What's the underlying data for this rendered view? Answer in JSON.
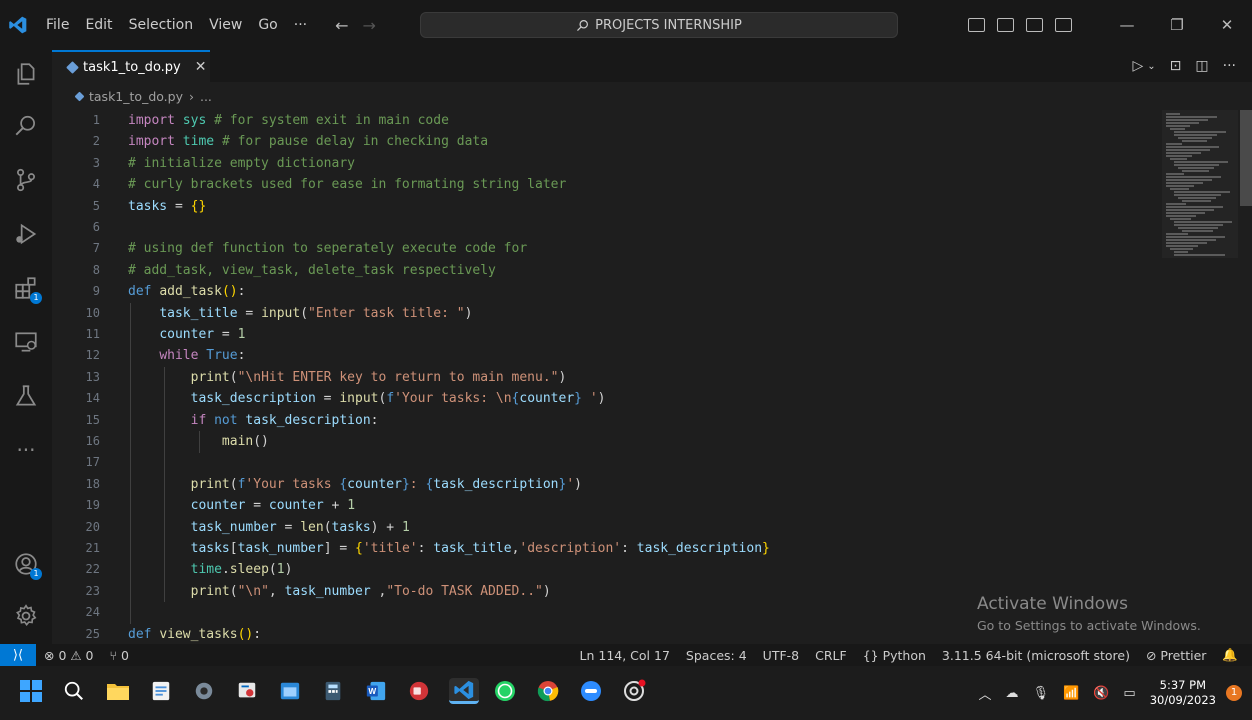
{
  "titlebar": {
    "menu": [
      "File",
      "Edit",
      "Selection",
      "View",
      "Go",
      "···"
    ],
    "search": "PROJECTS INTERNSHIP"
  },
  "tab": {
    "filename": "task1_to_do.py",
    "close": "✕"
  },
  "breadcrumb": {
    "file": "task1_to_do.py",
    "sep": "›",
    "more": "..."
  },
  "editor": {
    "lines": [
      {
        "n": "1",
        "html": "<span class='kw'>import</span> <span class='mod'>sys</span> <span class='cm'># for system exit in main code</span>"
      },
      {
        "n": "2",
        "html": "<span class='kw'>import</span> <span class='mod'>time</span> <span class='cm'># for pause delay in checking data</span>"
      },
      {
        "n": "3",
        "html": "<span class='cm'># initialize empty dictionary</span>"
      },
      {
        "n": "4",
        "html": "<span class='cm'># curly brackets used for ease in formating string later</span>"
      },
      {
        "n": "5",
        "html": "<span class='var'>tasks</span> = <span class='br'>{}</span>"
      },
      {
        "n": "6",
        "html": ""
      },
      {
        "n": "7",
        "html": "<span class='cm'># using def function to seperately execute code for</span>"
      },
      {
        "n": "8",
        "html": "<span class='cm'># add_task, view_task, delete_task respectively</span>"
      },
      {
        "n": "9",
        "html": "<span class='kw2'>def</span> <span class='fn'>add_task</span><span class='br'>()</span>:"
      },
      {
        "n": "10",
        "html": "    <span class='var'>task_title</span> = <span class='fn'>input</span>(<span class='str'>\"Enter task title: \"</span>)"
      },
      {
        "n": "11",
        "html": "    <span class='var'>counter</span> = <span class='num'>1</span>"
      },
      {
        "n": "12",
        "html": "    <span class='kw'>while</span> <span class='kw2'>True</span>:"
      },
      {
        "n": "13",
        "html": "        <span class='fn'>print</span>(<span class='str'>\"\\nHit ENTER key to return to main menu.\"</span>)"
      },
      {
        "n": "14",
        "html": "        <span class='var'>task_description</span> = <span class='fn'>input</span>(<span class='kw2'>f</span><span class='str'>'Your tasks: \\n</span><span class='kw2'>{</span><span class='var'>counter</span><span class='kw2'>}</span><span class='str'> '</span>)"
      },
      {
        "n": "15",
        "html": "        <span class='kw'>if</span> <span class='kw2'>not</span> <span class='var'>task_description</span>:"
      },
      {
        "n": "16",
        "html": "            <span class='fn'>main</span>()"
      },
      {
        "n": "17",
        "html": ""
      },
      {
        "n": "18",
        "html": "        <span class='fn'>print</span>(<span class='kw2'>f</span><span class='str'>'Your tasks </span><span class='kw2'>{</span><span class='var'>counter</span><span class='kw2'>}</span><span class='str'>: </span><span class='kw2'>{</span><span class='var'>task_description</span><span class='kw2'>}</span><span class='str'>'</span>)"
      },
      {
        "n": "19",
        "html": "        <span class='var'>counter</span> = <span class='var'>counter</span> + <span class='num'>1</span>"
      },
      {
        "n": "20",
        "html": "        <span class='var'>task_number</span> = <span class='fn'>len</span>(<span class='var'>tasks</span>) + <span class='num'>1</span>"
      },
      {
        "n": "21",
        "html": "        <span class='var'>tasks</span>[<span class='var'>task_number</span>] = <span class='br'>{</span><span class='str'>'title'</span>: <span class='var'>task_title</span>,<span class='str'>'description'</span>: <span class='var'>task_description</span><span class='br'>}</span>"
      },
      {
        "n": "22",
        "html": "        <span class='mod'>time</span>.<span class='fn'>sleep</span>(<span class='num'>1</span>)"
      },
      {
        "n": "23",
        "html": "        <span class='fn'>print</span>(<span class='str'>\"\\n\"</span>, <span class='var'>task_number</span> ,<span class='str'>\"To-do TASK ADDED..\"</span>)"
      },
      {
        "n": "24",
        "html": ""
      },
      {
        "n": "25",
        "html": "<span class='kw2'>def</span> <span class='fn'>view_tasks</span><span class='br'>()</span>:"
      }
    ]
  },
  "watermark": {
    "title": "Activate Windows",
    "subtitle": "Go to Settings to activate Windows."
  },
  "statusbar": {
    "problems": "⊗ 0 ⚠ 0",
    "ports": "⑂ 0",
    "position": "Ln 114, Col 17",
    "spaces": "Spaces: 4",
    "encoding": "UTF-8",
    "eol": "CRLF",
    "language": "{} Python",
    "interpreter": "3.11.5 64-bit (microsoft store)",
    "formatter": "⊘ Prettier",
    "bell": "🔔"
  },
  "taskbar": {
    "time": "5:37 PM",
    "date": "30/09/2023",
    "notifications": "1"
  },
  "colors": {
    "accent": "#0078d4",
    "editor_bg": "#1e1e1e",
    "chrome_bg": "#181818"
  }
}
